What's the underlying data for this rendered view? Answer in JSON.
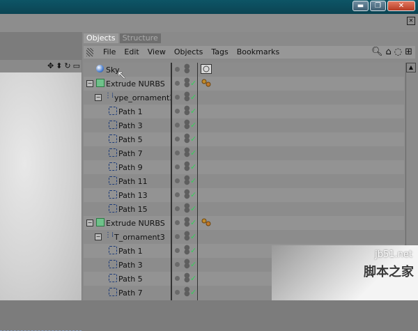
{
  "window": {
    "buttons": [
      "min",
      "restore",
      "close"
    ]
  },
  "panel": {
    "tabs": [
      {
        "label": "Objects",
        "active": true
      },
      {
        "label": "Structure",
        "active": false
      }
    ],
    "menus": [
      "File",
      "Edit",
      "View",
      "Objects",
      "Tags",
      "Bookmarks"
    ],
    "rows": [
      {
        "label": "Sky",
        "type": "sky",
        "depth": 0
      },
      {
        "label": "Extrude NURBS",
        "type": "cube",
        "depth": 0
      },
      {
        "label": "ype_ornament3",
        "type": "spline",
        "depth": 1
      },
      {
        "label": "Path 1",
        "type": "path",
        "depth": 2
      },
      {
        "label": "Path 3",
        "type": "path",
        "depth": 2
      },
      {
        "label": "Path 5",
        "type": "path",
        "depth": 2
      },
      {
        "label": "Path 7",
        "type": "path",
        "depth": 2
      },
      {
        "label": "Path 9",
        "type": "path",
        "depth": 2
      },
      {
        "label": "Path 11",
        "type": "path",
        "depth": 2
      },
      {
        "label": "Path 13",
        "type": "path",
        "depth": 2
      },
      {
        "label": "Path 15",
        "type": "path",
        "depth": 2
      },
      {
        "label": "Extrude NURBS",
        "type": "cube",
        "depth": 0
      },
      {
        "label": "T_ornament3",
        "type": "spline",
        "depth": 1
      },
      {
        "label": "Path 1",
        "type": "path",
        "depth": 2
      },
      {
        "label": "Path 3",
        "type": "path",
        "depth": 2
      },
      {
        "label": "Path 5",
        "type": "path",
        "depth": 2
      },
      {
        "label": "Path 7",
        "type": "path",
        "depth": 2
      }
    ]
  },
  "watermark": {
    "line1": "jb51.net",
    "line2": "脚本之家"
  }
}
